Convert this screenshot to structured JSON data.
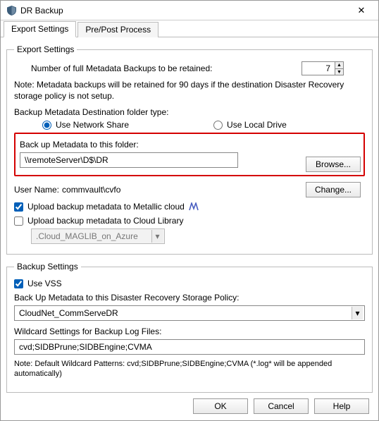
{
  "window": {
    "title": "DR Backup",
    "close": "✕"
  },
  "tabs": {
    "export": "Export Settings",
    "prepost": "Pre/Post Process"
  },
  "export": {
    "legend": "Export Settings",
    "retain_label": "Number of full Metadata Backups to be retained:",
    "retain_value": "7",
    "note": "Note: Metadata backups will be retained for 90 days if the destination Disaster Recovery storage policy is not setup.",
    "dest_type_label": "Backup Metadata Destination folder type:",
    "radio_network": "Use Network Share",
    "radio_local": "Use Local Drive",
    "backup_folder_label": "Back up Metadata to this folder:",
    "backup_folder_value": "\\\\remoteServer\\D$\\DR",
    "browse": "Browse...",
    "username_label": "User Name:",
    "username_value": "commvault\\cvfo",
    "change": "Change...",
    "chk_metallic": "Upload backup metadata to Metallic cloud",
    "chk_cloudlib": "Upload backup metadata to Cloud Library",
    "cloud_combo": ".Cloud_MAGLIB_on_Azure"
  },
  "backup": {
    "legend": "Backup Settings",
    "use_vss": "Use VSS",
    "policy_label": "Back Up Metadata to this Disaster Recovery Storage Policy:",
    "policy_value": "CloudNet_CommServeDR",
    "wildcard_label": "Wildcard Settings for Backup Log Files:",
    "wildcard_value": "cvd;SIDBPrune;SIDBEngine;CVMA",
    "note": "Note: Default Wildcard Patterns: cvd;SIDBPrune;SIDBEngine;CVMA (*.log* will be appended automatically)"
  },
  "buttons": {
    "ok": "OK",
    "cancel": "Cancel",
    "help": "Help"
  }
}
